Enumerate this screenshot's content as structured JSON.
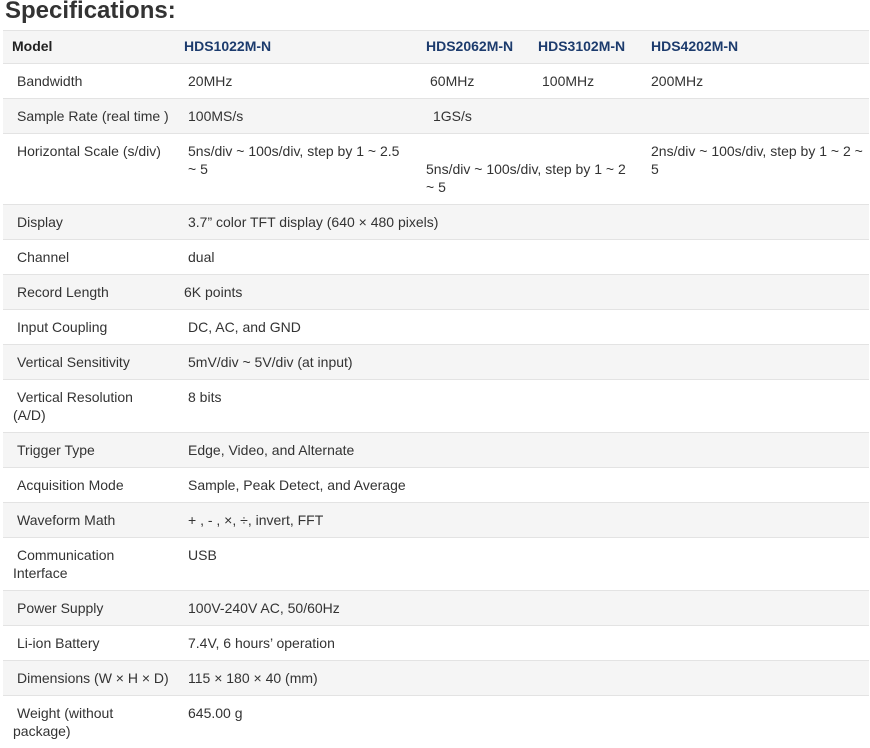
{
  "title": "Specifications:",
  "colors": {
    "model_name": "#1c3b6d",
    "text": "#333333",
    "row_stripe": "#f5f5f5",
    "row_border": "#e3e3e3"
  },
  "table": {
    "header": {
      "label": "Model",
      "models": [
        "HDS1022M-N",
        "HDS2062M-N",
        "HDS3102M-N",
        "HDS4202M-N"
      ]
    },
    "rows": [
      {
        "label": "Bandwidth",
        "values": [
          "20MHz",
          "60MHz",
          "100MHz",
          "200MHz"
        ]
      },
      {
        "label": "Sample Rate (real time )",
        "values": [
          "100MS/s",
          "1GS/s"
        ]
      },
      {
        "label": "Horizontal Scale (s/div)",
        "values": [
          "5ns/div ~ 100s/div, step by 1 ~ 2.5 ~ 5",
          "5ns/div ~ 100s/div, step by 1 ~ 2 ~ 5",
          "2ns/div ~ 100s/div, step by 1 ~ 2 ~ 5"
        ]
      },
      {
        "label": "Display",
        "values": [
          "3.7” color TFT display (640 × 480 pixels)"
        ]
      },
      {
        "label": "Channel",
        "values": [
          "dual"
        ]
      },
      {
        "label": "Record Length",
        "values": [
          "6K points"
        ]
      },
      {
        "label": "Input Coupling",
        "values": [
          "DC, AC, and GND"
        ]
      },
      {
        "label": "Vertical Sensitivity",
        "values": [
          "5mV/div ~ 5V/div (at input)"
        ]
      },
      {
        "label": "Vertical Resolution (A/D)",
        "values": [
          "8 bits"
        ]
      },
      {
        "label": "Trigger Type",
        "values": [
          "Edge, Video, and Alternate"
        ]
      },
      {
        "label": "Acquisition Mode",
        "values": [
          "Sample, Peak Detect, and Average"
        ]
      },
      {
        "label": "Waveform Math",
        "values": [
          "+ , - , ×, ÷, invert, FFT"
        ]
      },
      {
        "label": "Communication Interface",
        "values": [
          "USB"
        ]
      },
      {
        "label": "Power Supply",
        "values": [
          "100V-240V AC, 50/60Hz"
        ]
      },
      {
        "label": "Li-ion Battery",
        "values": [
          "7.4V, 6 hours’ operation"
        ]
      },
      {
        "label": "Dimensions (W × H × D)",
        "values": [
          "115 × 180 × 40 (mm)"
        ]
      },
      {
        "label": "Weight (without package)",
        "values": [
          "645.00 g"
        ]
      }
    ]
  }
}
